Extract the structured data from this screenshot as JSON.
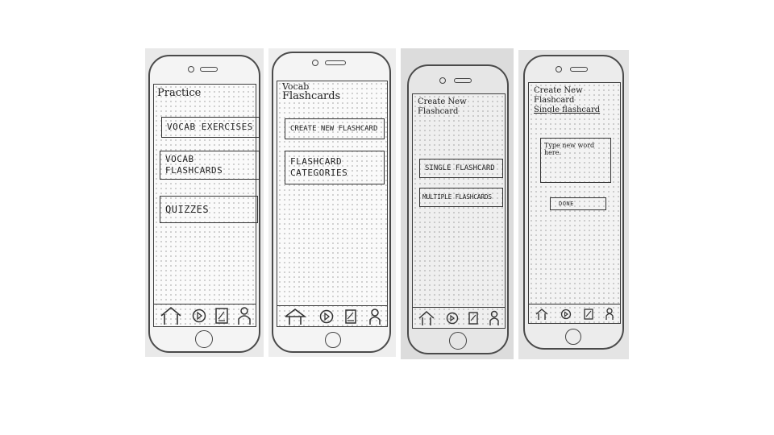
{
  "screens": [
    {
      "title": "Practice",
      "buttons": [
        "VOCAB EXERCISES",
        "VOCAB\nFLASHCARDS",
        "QUIZZES"
      ]
    },
    {
      "title_line1": "Vocab",
      "title_line2": "Flashcards",
      "buttons": [
        "CREATE NEW FLASHCARD",
        "FLASHCARD\nCATEGORIES"
      ]
    },
    {
      "title_line1": "Create New",
      "title_line2": "Flashcard",
      "buttons": [
        "SINGLE FLASHCARD",
        "MULTIPLE FLASHCARDS"
      ]
    },
    {
      "title_line1": "Create New",
      "title_line2": "Flashcard",
      "subtitle": "Single flashcard",
      "input_placeholder": "Type new word here.",
      "done_label": "DONE"
    }
  ],
  "tabbar_icons": [
    "home-icon",
    "play-icon",
    "card-edit-icon",
    "profile-icon"
  ]
}
